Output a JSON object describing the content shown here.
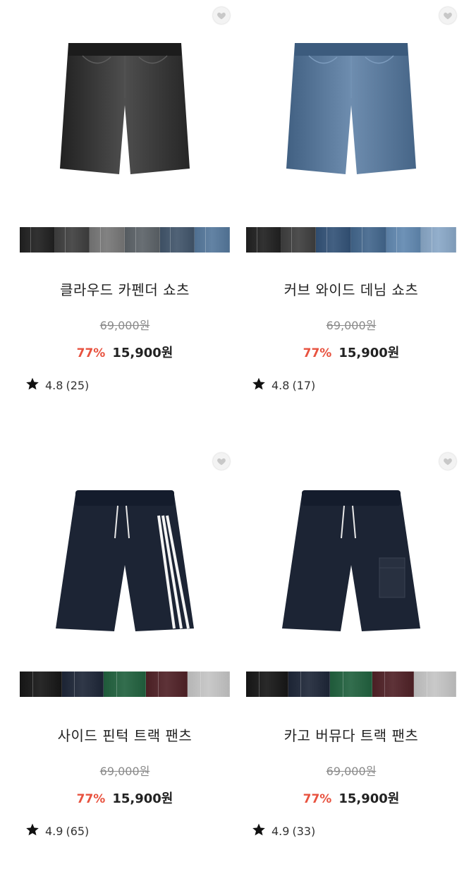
{
  "products": [
    {
      "name": "클라우드 카펜더 쇼츠",
      "original_price": "69,000원",
      "discount": "77%",
      "sale_price": "15,900원",
      "rating": "4.8",
      "review_count": "(25)",
      "style": "denim",
      "main_color": "#2b2b2b",
      "swatch_colors": [
        "#1e1e1e",
        "#3a3a3a",
        "#6e6e6e",
        "#555b60",
        "#3d4f63",
        "#4f6f90"
      ]
    },
    {
      "name": "커브 와이드 데님 쇼츠",
      "original_price": "69,000원",
      "discount": "77%",
      "sale_price": "15,900원",
      "rating": "4.8",
      "review_count": "(17)",
      "style": "denim",
      "main_color": "#4b6a8c",
      "swatch_colors": [
        "#1e1e1e",
        "#3a3a3a",
        "#2f4c6e",
        "#3e5f82",
        "#5a7ea3",
        "#7f9bb8"
      ]
    },
    {
      "name": "사이드 핀턱 트랙 팬츠",
      "original_price": "69,000원",
      "discount": "77%",
      "sale_price": "15,900원",
      "rating": "4.9",
      "review_count": "(65)",
      "style": "track-stripes",
      "main_color": "#1c2434",
      "swatch_colors": [
        "#151515",
        "#1c2434",
        "#1f5a3a",
        "#4a1f24",
        "#b5b5b5"
      ]
    },
    {
      "name": "카고 버뮤다 트랙 팬츠",
      "original_price": "69,000원",
      "discount": "77%",
      "sale_price": "15,900원",
      "rating": "4.9",
      "review_count": "(33)",
      "style": "track-cargo",
      "main_color": "#1c2434",
      "swatch_colors": [
        "#151515",
        "#1c2434",
        "#1f5a3a",
        "#4a1f24",
        "#b5b5b5"
      ]
    }
  ],
  "icons": {
    "wishlist": "heart-icon",
    "rating": "star-icon"
  }
}
